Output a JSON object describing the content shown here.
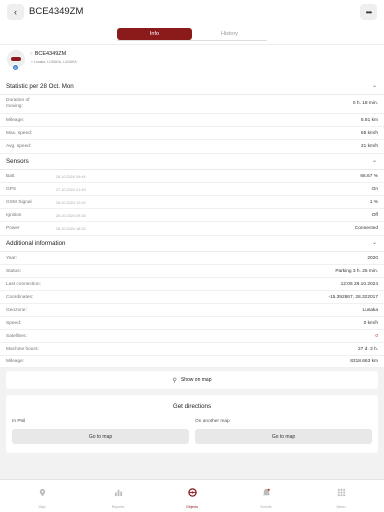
{
  "header": {
    "back_icon": "chevron-left-icon",
    "title": "BCE4349ZM",
    "more_icon": "more-dots-icon"
  },
  "tabs": [
    {
      "label": "Info",
      "active": true
    },
    {
      "label": "History",
      "active": false
    }
  ],
  "object": {
    "name": "BCE4349ZM",
    "address": "Lusaka, LUSAKA, LUSAKA",
    "badge": "6"
  },
  "statistic": {
    "title": "Statistic per 28 Oct. Mon",
    "rows": [
      {
        "label": "Duration of moving:",
        "value": "0 h. 18 min."
      },
      {
        "label": "Mileage:",
        "value": "5.81 km"
      },
      {
        "label": "Max. speed:",
        "value": "65 km/h"
      },
      {
        "label": "Avg. speed:",
        "value": "31 km/h"
      }
    ]
  },
  "sensors": {
    "title": "Sensors",
    "rows": [
      {
        "label": "Batt",
        "date": "28.10.2024 09:44",
        "value": "66.67 %"
      },
      {
        "label": "GPS",
        "date": "27.10.2024 21:43",
        "value": "On"
      },
      {
        "label": "GSM Signal",
        "date": "28.10.2024 12:02",
        "value": "1 %"
      },
      {
        "label": "Ignition",
        "date": "28.10.2024 09:28",
        "value": "Off"
      },
      {
        "label": "Power",
        "date": "28.10.2024 18:23",
        "value": "Connected"
      }
    ]
  },
  "additional": {
    "title": "Additional information",
    "rows": [
      {
        "label": "Year:",
        "value": "2020"
      },
      {
        "label": "Status:",
        "value": "Parking 3 h. 25 min."
      },
      {
        "label": "Last connection:",
        "value": "12:06 28.10.2024"
      },
      {
        "label": "Coordinates:",
        "value": "-15.392867, 28.322017"
      },
      {
        "label": "Geozone:",
        "value": "Lusaka"
      },
      {
        "label": "Speed:",
        "value": "0 km/h"
      },
      {
        "label": "Satellites:",
        "value": "0"
      },
      {
        "label": "Machine hours:",
        "value": "27 d. 3 h."
      },
      {
        "label": "Mileage:",
        "value": "8318.663 km"
      }
    ]
  },
  "show_on_map": "Show on map",
  "directions": {
    "title": "Get directions",
    "left_label": "In Ptsl",
    "right_label": "On another map",
    "button_left": "Go to map",
    "button_right": "Go to map"
  },
  "nav": [
    {
      "label": "Map",
      "icon": "map-pin-icon"
    },
    {
      "label": "Reports",
      "icon": "bar-chart-icon"
    },
    {
      "label": "Objects",
      "icon": "steering-wheel-icon"
    },
    {
      "label": "Events",
      "icon": "bell-icon"
    },
    {
      "label": "Menu",
      "icon": "grid-icon"
    }
  ],
  "colors": {
    "accent": "#8b1a1a",
    "background": "#f2f2f2",
    "badge": "#3a7bd5",
    "alert": "#c0392b"
  }
}
